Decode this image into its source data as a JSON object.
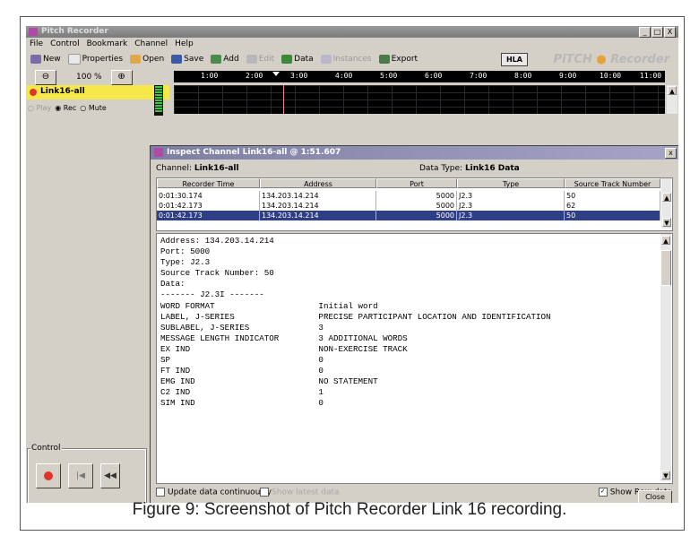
{
  "app": {
    "title": "Pitch Recorder",
    "window_controls": [
      "_",
      "□",
      "X"
    ]
  },
  "menu": [
    "File",
    "Control",
    "Bookmark",
    "Channel",
    "Help"
  ],
  "toolbar": {
    "new": "New",
    "properties": "Properties",
    "open": "Open",
    "save": "Save",
    "add": "Add",
    "edit": "Edit",
    "data": "Data",
    "instances": "Instances",
    "export": "Export",
    "hla_badge": "HLA",
    "logo_left": "PiTCH",
    "logo_right": "Recorder"
  },
  "zoom": {
    "value": "100 %",
    "out_icon": "zoom-out-icon",
    "in_icon": "zoom-in-icon"
  },
  "timeline": {
    "ticks": [
      "1:00",
      "2:00",
      "3:00",
      "4:00",
      "5:00",
      "6:00",
      "7:00",
      "8:00",
      "9:00",
      "10:00",
      "11:00"
    ]
  },
  "channel": {
    "name": "Link16-all",
    "modes": [
      "Play",
      "Rec",
      "Mute"
    ],
    "selected_mode": "Rec"
  },
  "control": {
    "label": "Control"
  },
  "dialog": {
    "title": "Inspect Channel Link16-all @ 1:51.607",
    "channel_label": "Channel:",
    "channel_value": "Link16-all",
    "data_type_label": "Data Type:",
    "data_type_value": "Link16 Data",
    "columns": [
      "Recorder Time",
      "Address",
      "Port",
      "Type",
      "Source Track Number"
    ],
    "rows": [
      [
        "0:01:30.174",
        "134.203.14.214",
        "5000",
        "J2.3",
        "50"
      ],
      [
        "0:01:42.173",
        "134.203.14.214",
        "5000",
        "J2.3",
        "62"
      ],
      [
        "0:01:42.173",
        "134.203.14.214",
        "5000",
        "J2.3",
        "50"
      ]
    ],
    "selected_row": 2,
    "raw_text": "Address: 134.203.14.214\nPort: 5000\nType: J2.3\nSource Track Number: 50\nData:\n------- J2.3I -------\nWORD FORMAT                     Initial word\nLABEL, J-SERIES                 PRECISE PARTICIPANT LOCATION AND IDENTIFICATION\nSUBLABEL, J-SERIES              3\nMESSAGE LENGTH INDICATOR        3 ADDITIONAL WORDS\nEX IND                          NON-EXERCISE TRACK\nSP                              0\nFT IND                          0\nEMG IND                         NO STATEMENT\nC2 IND                          1\nSIM IND                         0",
    "update_label": "Update data continuously",
    "show_latest_label": "Show latest data",
    "show_raw_label": "Show Raw data",
    "show_raw_checked": true,
    "close_label": "Close"
  },
  "caption": "Figure 9: Screenshot of Pitch Recorder Link 16 recording."
}
